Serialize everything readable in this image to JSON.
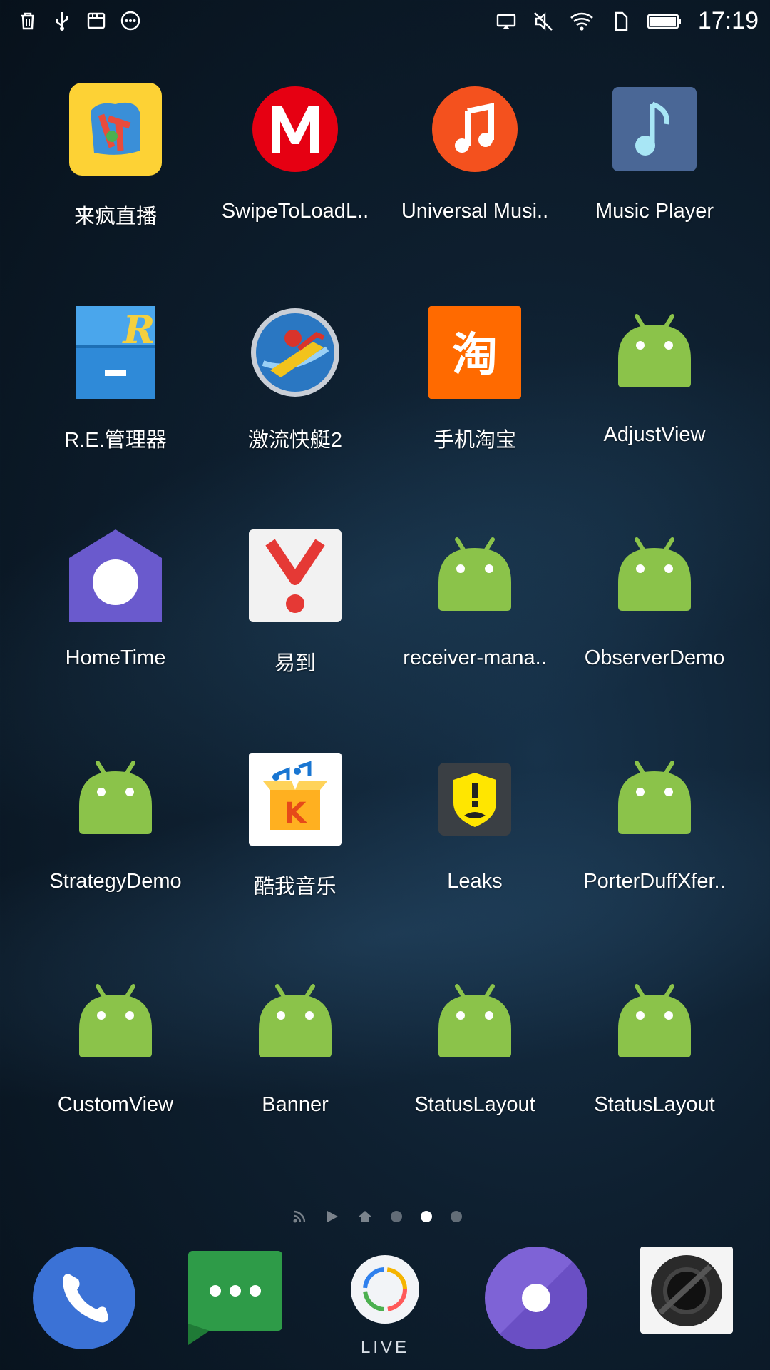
{
  "status_bar": {
    "time": "17:19",
    "left_icons": [
      "trash-icon",
      "usb-icon",
      "sd-card-icon",
      "more-dots-icon"
    ],
    "right_icons": [
      "cast-icon",
      "mute-icon",
      "wifi-icon",
      "sim-icon",
      "battery-icon"
    ]
  },
  "apps": [
    {
      "label": "来疯直播",
      "icon": "laifeng-icon"
    },
    {
      "label": "SwipeToLoadL..",
      "icon": "m-icon"
    },
    {
      "label": "Universal Musi..",
      "icon": "music-note-icon"
    },
    {
      "label": "Music Player",
      "icon": "music-player-icon"
    },
    {
      "label": "R.E.管理器",
      "icon": "file-cabinet-icon"
    },
    {
      "label": "激流快艇2",
      "icon": "jetski-icon"
    },
    {
      "label": "手机淘宝",
      "icon": "taobao-icon"
    },
    {
      "label": "AdjustView",
      "icon": "android-icon"
    },
    {
      "label": "HomeTime",
      "icon": "hometime-icon"
    },
    {
      "label": "易到",
      "icon": "yidao-icon"
    },
    {
      "label": "receiver-mana..",
      "icon": "android-icon"
    },
    {
      "label": "ObserverDemo",
      "icon": "android-icon"
    },
    {
      "label": "StrategyDemo",
      "icon": "android-icon"
    },
    {
      "label": "酷我音乐",
      "icon": "kuwo-icon"
    },
    {
      "label": "Leaks",
      "icon": "leaks-icon"
    },
    {
      "label": "PorterDuffXfer..",
      "icon": "android-icon"
    },
    {
      "label": "CustomView",
      "icon": "android-icon"
    },
    {
      "label": "Banner",
      "icon": "android-icon"
    },
    {
      "label": "StatusLayout",
      "icon": "android-icon"
    },
    {
      "label": "StatusLayout",
      "icon": "android-icon"
    }
  ],
  "pager": {
    "pages": [
      "feed-icon",
      "play-icon",
      "home-icon",
      "page-1",
      "page-2",
      "page-3"
    ],
    "active_index": 4
  },
  "dock": [
    {
      "name": "phone",
      "icon": "phone-icon"
    },
    {
      "name": "messages",
      "icon": "messages-icon"
    },
    {
      "name": "live",
      "icon": "live-icon",
      "label": "LIVE"
    },
    {
      "name": "music",
      "icon": "disc-icon"
    },
    {
      "name": "camera",
      "icon": "camera-icon"
    }
  ],
  "colors": {
    "android_green": "#8bc34a",
    "accent_blue": "#3b72d6"
  }
}
